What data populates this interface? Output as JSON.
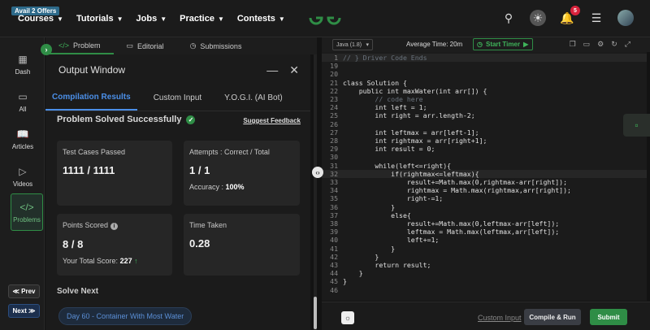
{
  "offers_badge": "Avail 2 Offers",
  "nav": [
    "Courses",
    "Tutorials",
    "Jobs",
    "Practice",
    "Contests"
  ],
  "notification_count": "5",
  "leftnav": {
    "items": [
      {
        "label": "Dash",
        "icon": "grid-icon"
      },
      {
        "label": "All",
        "icon": "file-icon"
      },
      {
        "label": "Articles",
        "icon": "book-icon"
      },
      {
        "label": "Videos",
        "icon": "video-icon"
      },
      {
        "label": "Problems",
        "icon": "code-icon"
      }
    ],
    "prev": "≪ Prev",
    "next": "Next ≫"
  },
  "problem_tabs": [
    "Problem",
    "Editorial",
    "Submissions"
  ],
  "output": {
    "title": "Output Window",
    "tabs": [
      "Compilation Results",
      "Custom Input",
      "Y.O.G.I. (AI Bot)"
    ],
    "status": "Problem Solved Successfully",
    "feedback": "Suggest Feedback",
    "cards": {
      "tests_label": "Test Cases Passed",
      "tests_value": "1111 / 1111",
      "attempts_label": "Attempts : Correct / Total",
      "attempts_value": "1 / 1",
      "accuracy_label": "Accuracy :",
      "accuracy_value": "100%",
      "points_label": "Points Scored",
      "points_value": "8 / 8",
      "total_label": "Your Total Score:",
      "total_value": "227",
      "time_label": "Time Taken",
      "time_value": "0.28"
    },
    "solve_next": "Solve Next",
    "next_problem": "Day 60 - Container With Most Water"
  },
  "editor": {
    "language": "Java (1.8)",
    "avg_time": "Average Time: 20m",
    "timer": "Start Timer",
    "custom_input": "Custom Input",
    "compile": "Compile & Run",
    "submit": "Submit",
    "lines": [
      {
        "n": "1",
        "code": "// } Driver Code Ends"
      },
      {
        "n": "19",
        "code": ""
      },
      {
        "n": "20",
        "code": ""
      },
      {
        "n": "21",
        "code": "class Solution {"
      },
      {
        "n": "22",
        "code": "    public int maxWater(int arr[]) {"
      },
      {
        "n": "23",
        "code": "        // code here"
      },
      {
        "n": "24",
        "code": "        int left = 1;"
      },
      {
        "n": "25",
        "code": "        int right = arr.length-2;"
      },
      {
        "n": "26",
        "code": ""
      },
      {
        "n": "27",
        "code": "        int leftmax = arr[left-1];"
      },
      {
        "n": "28",
        "code": "        int rightmax = arr[right+1];"
      },
      {
        "n": "29",
        "code": "        int result = 0;"
      },
      {
        "n": "30",
        "code": ""
      },
      {
        "n": "31",
        "code": "        while(left<=right){"
      },
      {
        "n": "32",
        "code": "            if(rightmax<=leftmax){"
      },
      {
        "n": "33",
        "code": "                result+=Math.max(0,rightmax-arr[right]);"
      },
      {
        "n": "34",
        "code": "                rightmax = Math.max(rightmax,arr[right]);"
      },
      {
        "n": "35",
        "code": "                right-=1;"
      },
      {
        "n": "36",
        "code": "            }"
      },
      {
        "n": "37",
        "code": "            else{"
      },
      {
        "n": "38",
        "code": "                result+=Math.max(0,leftmax-arr[left]);"
      },
      {
        "n": "39",
        "code": "                leftmax = Math.max(leftmax,arr[left]);"
      },
      {
        "n": "40",
        "code": "                left+=1;"
      },
      {
        "n": "41",
        "code": "            }"
      },
      {
        "n": "42",
        "code": "        }"
      },
      {
        "n": "43",
        "code": "        return result;"
      },
      {
        "n": "44",
        "code": "    }"
      },
      {
        "n": "45",
        "code": "}"
      },
      {
        "n": "46",
        "code": ""
      }
    ]
  }
}
